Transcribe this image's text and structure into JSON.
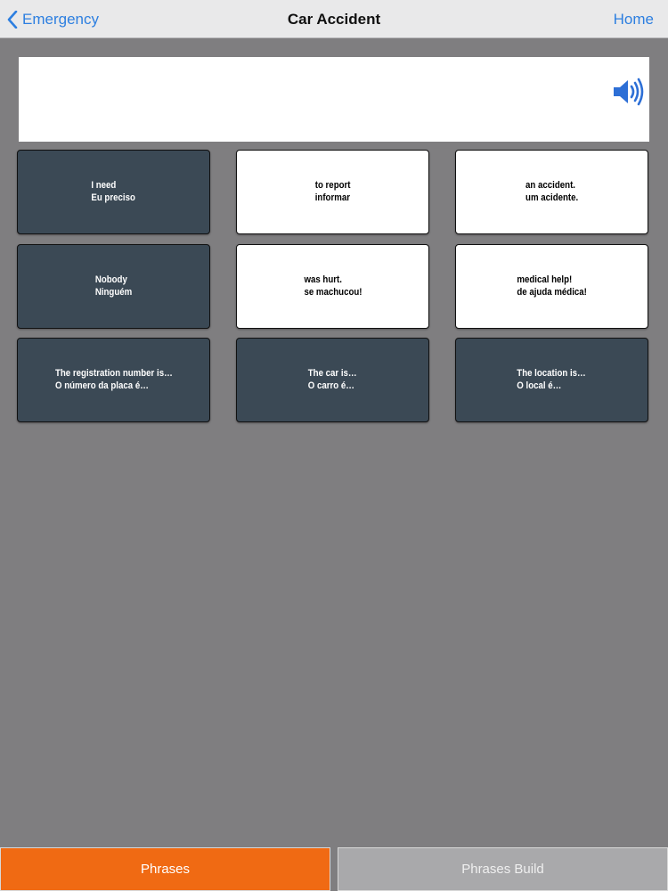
{
  "navbar": {
    "back_label": "Emergency",
    "title": "Car Accident",
    "home_label": "Home"
  },
  "output": {
    "text": ""
  },
  "tiles": [
    {
      "en": "I need",
      "pt": "Eu preciso",
      "style": "dark"
    },
    {
      "en": "to report",
      "pt": "informar",
      "style": "light"
    },
    {
      "en": "an accident.",
      "pt": "um acidente.",
      "style": "light"
    },
    {
      "en": "Nobody",
      "pt": "Ninguém",
      "style": "dark"
    },
    {
      "en": "was hurt.",
      "pt": "se machucou!",
      "style": "light"
    },
    {
      "en": "medical help!",
      "pt": "de ajuda médica!",
      "style": "light"
    },
    {
      "en": "The registration number is…",
      "pt": "O número da placa é…",
      "style": "dark"
    },
    {
      "en": "The car is…",
      "pt": "O carro é…",
      "style": "dark"
    },
    {
      "en": "The location is…",
      "pt": "O local é…",
      "style": "dark"
    }
  ],
  "tabs": {
    "phrases": "Phrases",
    "phrases_build": "Phrases Build"
  },
  "colors": {
    "accent": "#2d7fe0",
    "tab_active": "#f06a13",
    "tile_dark": "#3b4955",
    "background": "#7f7e80"
  },
  "icons": {
    "back": "chevron-left-icon",
    "speaker": "speaker-volume-icon"
  }
}
